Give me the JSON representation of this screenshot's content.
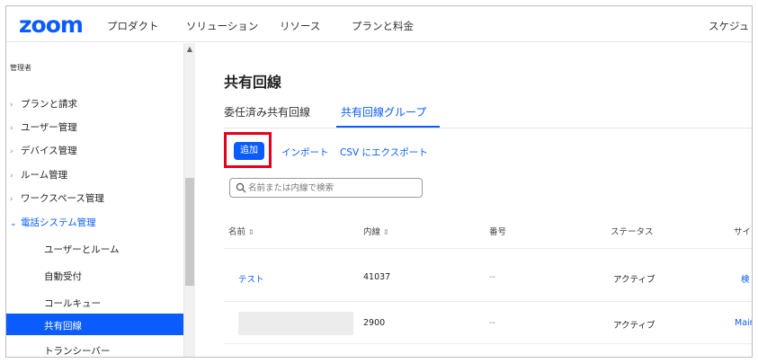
{
  "brand": {
    "logo": "zoom",
    "accent": "#0b5cff",
    "highlight": "#e3001b"
  },
  "topnav": {
    "items": [
      "プロダクト",
      "ソリューション",
      "リソース",
      "プランと料金",
      "スケジュ"
    ]
  },
  "sidebar": {
    "section_label": "管理者",
    "items": [
      {
        "label": "プランと請求",
        "icon": "chevron-right-icon"
      },
      {
        "label": "ユーザー管理",
        "icon": "chevron-right-icon"
      },
      {
        "label": "デバイス管理",
        "icon": "chevron-right-icon"
      },
      {
        "label": "ルーム管理",
        "icon": "chevron-right-icon"
      },
      {
        "label": "ワークスペース管理",
        "icon": "chevron-right-icon"
      },
      {
        "label": "電話システム管理",
        "icon": "chevron-down-icon"
      }
    ],
    "subitems": [
      "ユーザーとルーム",
      "自動受付",
      "コールキュー",
      "共有回線",
      "トランシーバー"
    ]
  },
  "main": {
    "title": "共有回線",
    "tabs": [
      "委任済み共有回線",
      "共有回線グループ"
    ],
    "active_tab": "共有回線グループ",
    "actions": {
      "add": "追加",
      "import": "インポート",
      "export": "CSV にエクスポート"
    },
    "search": {
      "placeholder": "名前または内線で検索",
      "value": ""
    },
    "table": {
      "columns": [
        "名前",
        "内線",
        "番号",
        "ステータス",
        "サイ"
      ],
      "rows": [
        {
          "name": "テスト",
          "extension": "41037",
          "number": "--",
          "status": "アクティブ",
          "site": "検"
        },
        {
          "name": "",
          "extension": "2900",
          "number": "--",
          "status": "アクティブ",
          "site": "Mair"
        }
      ]
    }
  }
}
